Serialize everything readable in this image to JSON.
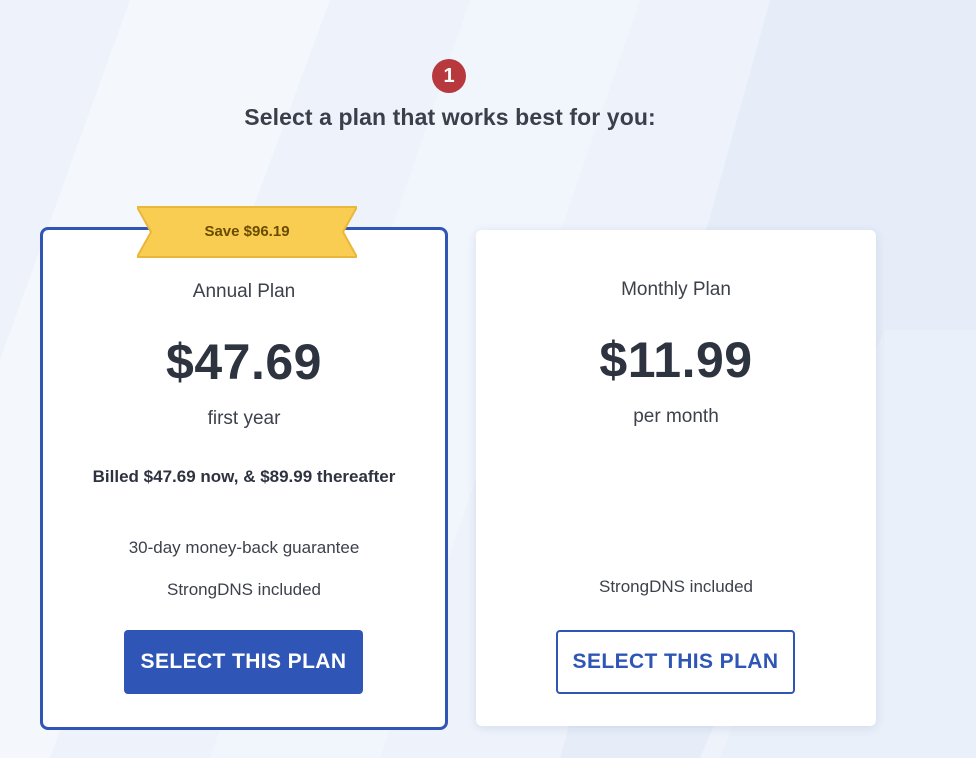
{
  "step": {
    "number": "1",
    "color": "#b8393d"
  },
  "headline": "Select a plan that works best for you:",
  "plans": [
    {
      "id": "annual",
      "highlighted": true,
      "badge": "Save $96.19",
      "name": "Annual Plan",
      "price": "$47.69",
      "period": "first year",
      "billing_note": "Billed $47.69 now, & $89.99 thereafter",
      "features": [
        "30-day money-back guarantee",
        "StrongDNS included"
      ],
      "cta": "SELECT THIS PLAN"
    },
    {
      "id": "monthly",
      "highlighted": false,
      "name": "Monthly Plan",
      "price": "$11.99",
      "period": "per month",
      "features": [
        "StrongDNS included"
      ],
      "cta": "SELECT THIS PLAN"
    }
  ],
  "colors": {
    "accent": "#2f55b6",
    "badge": "#f9cc52",
    "background": "#eef3fb",
    "text": "#363a44"
  },
  "icons": {
    "ribbon": "ribbon-banner-icon"
  }
}
